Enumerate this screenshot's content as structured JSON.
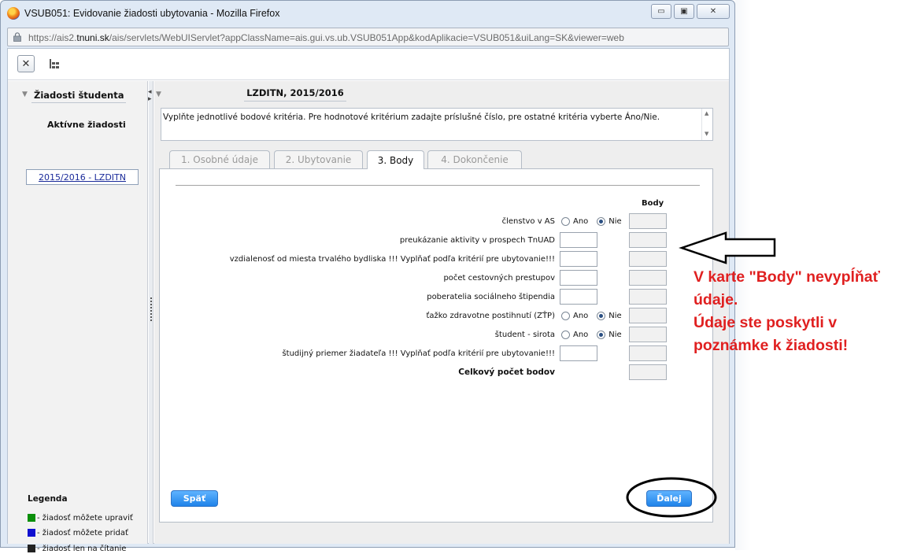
{
  "window": {
    "title": "VSUB051: Evidovanie žiadosti ubytovania - Mozilla Firefox",
    "url_prefix": "https://ais2.",
    "url_host": "tnuni.sk",
    "url_rest": "/ais/servlets/WebUIServlet?appClassName=ais.gui.vs.ub.VSUB051App&kodAplikacie=VSUB051&uiLang=SK&viewer=web",
    "buttons": {
      "minimize": "▭",
      "restore": "▣",
      "close": "✕"
    }
  },
  "toolbar": {
    "close_symbol": "✕"
  },
  "sidebar": {
    "title": "Žiadosti študenta",
    "section_title": "Aktívne žiadosti",
    "applications": [
      "2015/2016 - LZDITN"
    ],
    "legend": {
      "title": "Legenda",
      "items": [
        {
          "color": "#0a8f0a",
          "text": "- žiadosť môžete upraviť"
        },
        {
          "color": "#1010d0",
          "text": "- žiadosť môžete pridať"
        },
        {
          "color": "#222222",
          "text": "- žiadosť len na čítanie"
        }
      ]
    }
  },
  "main": {
    "context_title": "LZDITN, 2015/2016",
    "info_text": "Vyplňte jednotlivé bodové kritéria. Pre hodnotové kritérium zadajte príslušné číslo, pre ostatné kritéria vyberte Áno/Nie.",
    "tabs": [
      {
        "label": "1. Osobné údaje",
        "active": false
      },
      {
        "label": "2. Ubytovanie",
        "active": false
      },
      {
        "label": "3. Body",
        "active": true
      },
      {
        "label": "4. Dokončenie",
        "active": false
      }
    ],
    "points_header": "Body",
    "criteria": [
      {
        "label": "členstvo v AS",
        "type": "radio",
        "yes": "Ano",
        "no": "Nie",
        "selected": "Nie"
      },
      {
        "label": "preukázanie aktivity v prospech TnUAD",
        "type": "text",
        "value": ""
      },
      {
        "label": "vzdialenosť od miesta trvalého bydliska !!! Vyplňať podľa kritérií pre ubytovanie!!!",
        "type": "text",
        "value": ""
      },
      {
        "label": "počet cestovných prestupov",
        "type": "text",
        "value": ""
      },
      {
        "label": "poberatelia sociálneho štipendia",
        "type": "text",
        "value": ""
      },
      {
        "label": "ťažko zdravotne postihnutí (ZŤP)",
        "type": "radio",
        "yes": "Ano",
        "no": "Nie",
        "selected": "Nie"
      },
      {
        "label": "študent - sirota",
        "type": "radio",
        "yes": "Ano",
        "no": "Nie",
        "selected": "Nie"
      },
      {
        "label": "študijný priemer žiadateľa !!! Vyplňať podľa kritérií pre ubytovanie!!!",
        "type": "text",
        "value": ""
      }
    ],
    "total_label": "Celkový počet bodov",
    "back_button": "Späť",
    "next_button": "Ďalej"
  },
  "annotation": {
    "color": "#e02020",
    "lines": [
      "V karte \"Body\" nevypĺňať",
      "údaje.",
      "Údaje ste poskytli v",
      "poznámke k žiadosti!"
    ]
  }
}
